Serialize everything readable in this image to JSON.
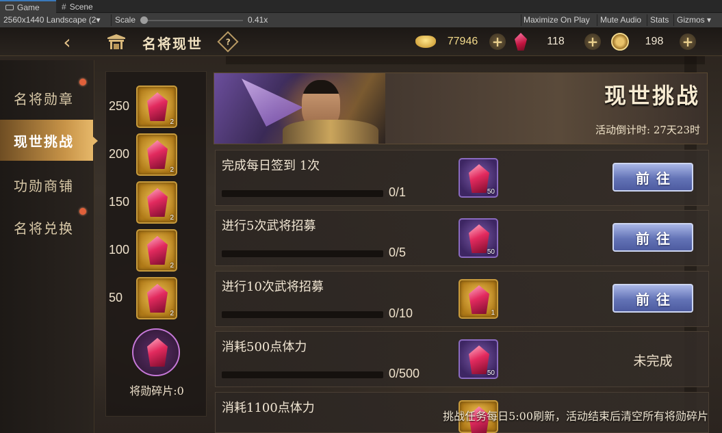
{
  "editor": {
    "tabs": [
      {
        "label": "Game"
      },
      {
        "label": "Scene"
      }
    ],
    "toolbar": {
      "resolution": "2560x1440 Landscape (2▾",
      "scale_label": "Scale",
      "scale_value": "0.41x",
      "maximize": "Maximize On Play",
      "mute": "Mute Audio",
      "stats": "Stats",
      "gizmos": "Gizmos ▾"
    }
  },
  "header": {
    "back_glyph": "‹",
    "title": "名将现世",
    "help": "?",
    "resources": [
      {
        "icon": "gold-ingot-icon",
        "value": "77946"
      },
      {
        "icon": "red-gem-icon",
        "value": "118"
      },
      {
        "icon": "copper-coin-icon",
        "value": "198"
      }
    ],
    "plus": "+"
  },
  "nav": {
    "items": [
      {
        "label": "名将勋章",
        "active": false,
        "dot": true
      },
      {
        "label": "现世挑战",
        "active": true,
        "dot": false
      },
      {
        "label": "功勋商铺",
        "active": false,
        "dot": false
      },
      {
        "label": "名将兑换",
        "active": false,
        "dot": true
      }
    ]
  },
  "milestones": {
    "rows": [
      {
        "value": "250",
        "count": "2"
      },
      {
        "value": "200",
        "count": "2"
      },
      {
        "value": "150",
        "count": "2"
      },
      {
        "value": "100",
        "count": "2"
      },
      {
        "value": "50",
        "count": "2"
      }
    ],
    "fragment_label": "将勋碎片:0"
  },
  "banner": {
    "title": "现世挑战",
    "countdown": "活动倒计时: 27天23时"
  },
  "tasks": [
    {
      "name": "完成每日签到 1次",
      "progress": "0/1",
      "progress_fraction": 0,
      "reward_count": "50",
      "reward_tier": "purple",
      "action": "前往",
      "action_type": "button"
    },
    {
      "name": "进行5次武将招募",
      "progress": "0/5",
      "progress_fraction": 0,
      "reward_count": "50",
      "reward_tier": "purple",
      "action": "前往",
      "action_type": "button"
    },
    {
      "name": "进行10次武将招募",
      "progress": "0/10",
      "progress_fraction": 0,
      "reward_count": "1",
      "reward_tier": "gold",
      "action": "前往",
      "action_type": "button"
    },
    {
      "name": "消耗500点体力",
      "progress": "0/500",
      "progress_fraction": 0,
      "reward_count": "50",
      "reward_tier": "purple",
      "action": "未完成",
      "action_type": "status"
    },
    {
      "name": "消耗1100点体力",
      "progress": "",
      "progress_fraction": 0,
      "reward_count": "",
      "reward_tier": "gold",
      "action": "",
      "action_type": "none"
    }
  ],
  "footer_note": "挑战任务每日5:00刷新，活动结束后清空所有将勋碎片",
  "colors": {
    "accent_gold": "#c89448",
    "go_button": "#6373b6",
    "notify_dot": "#e0603a"
  }
}
